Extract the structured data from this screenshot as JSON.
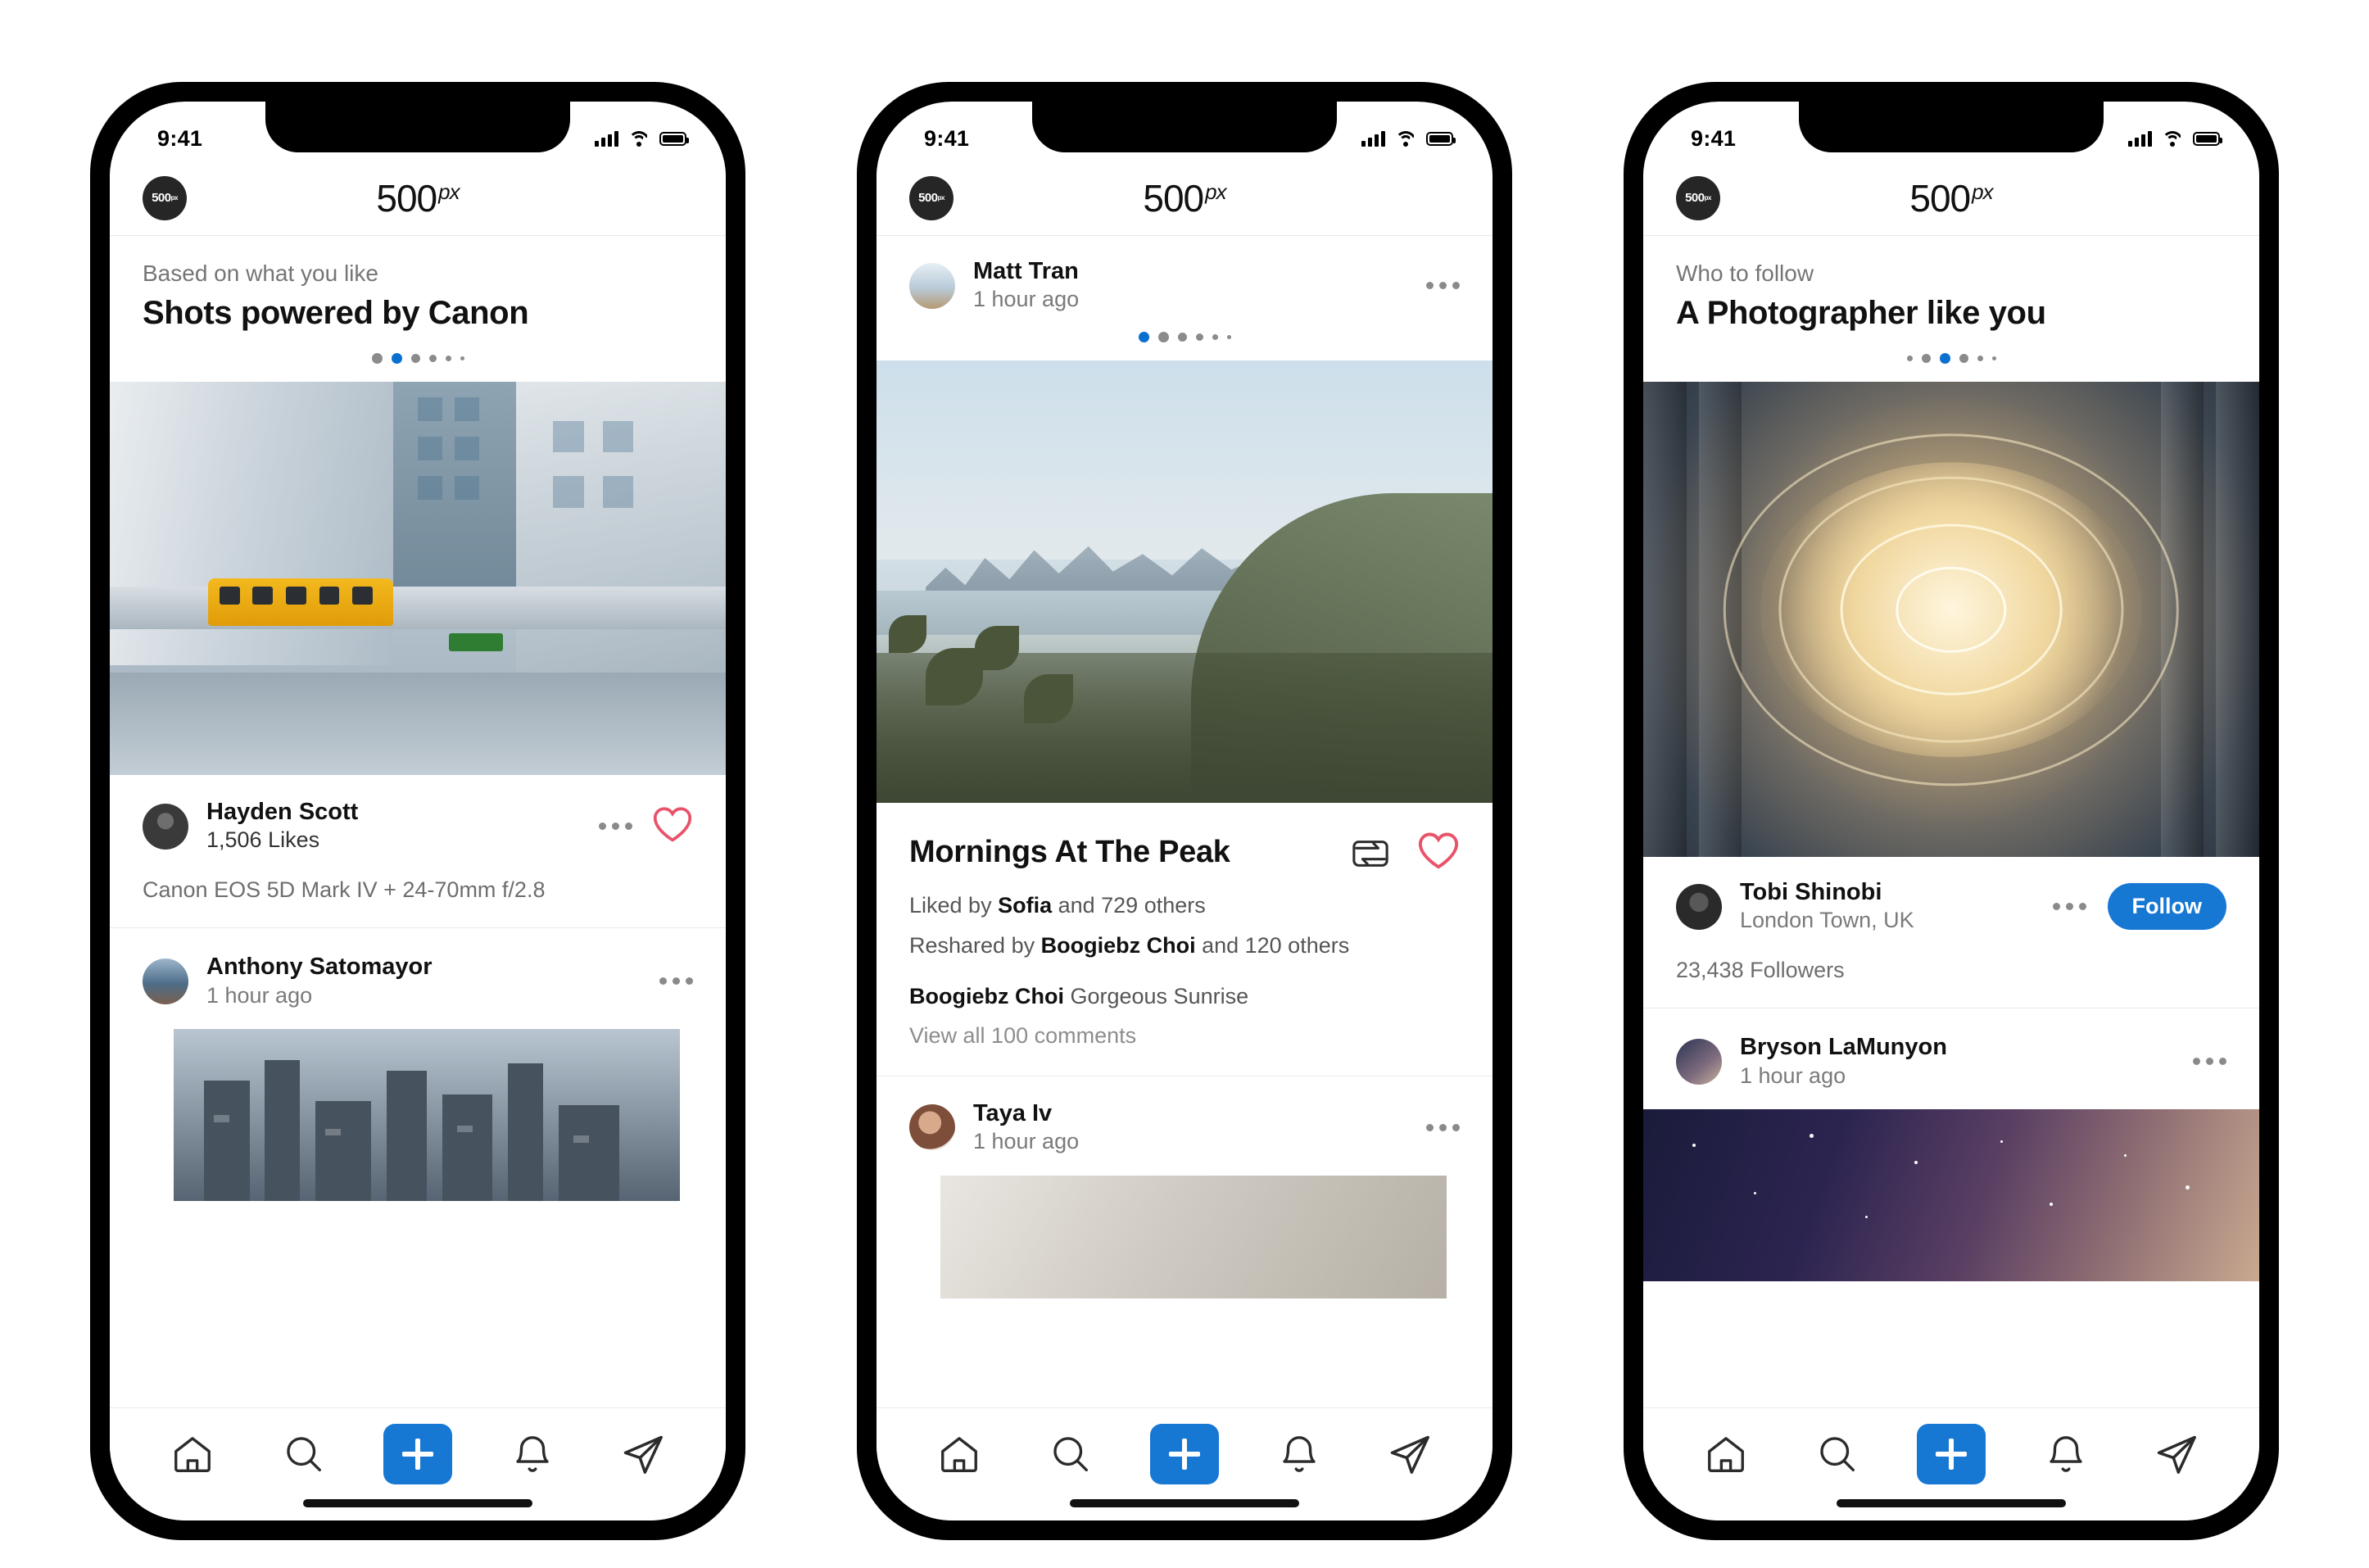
{
  "app": {
    "brand_name": "500",
    "brand_suffix": "px",
    "logo_text": "500",
    "logo_sup": "px"
  },
  "status_bar": {
    "time": "9:41",
    "signal_icon": "cellular-signal-icon",
    "wifi_icon": "wifi-icon",
    "battery_icon": "battery-icon"
  },
  "tab_bar": {
    "items": [
      {
        "name": "home",
        "icon": "home-icon"
      },
      {
        "name": "search",
        "icon": "search-icon"
      },
      {
        "name": "create",
        "icon": "plus-icon"
      },
      {
        "name": "notifications",
        "icon": "bell-icon"
      },
      {
        "name": "messages",
        "icon": "send-icon"
      }
    ]
  },
  "phones": [
    {
      "id": "phone-1",
      "section": {
        "kicker": "Based on what you like",
        "headline": "Shots powered by Canon",
        "pager": {
          "count": 6,
          "active_index": 1
        }
      },
      "post": {
        "author": "Hayden Scott",
        "likes": "1,506 Likes",
        "exif": "Canon EOS 5D Mark IV + 24-70mm f/2.8",
        "more_icon": "more-options-icon",
        "like_icon": "heart-icon"
      },
      "next_post": {
        "author": "Anthony Satomayor",
        "time": "1 hour ago",
        "more_icon": "more-options-icon"
      }
    },
    {
      "id": "phone-2",
      "post_header": {
        "author": "Matt Tran",
        "time": "1 hour ago",
        "more_icon": "more-options-icon",
        "pager": {
          "count": 6,
          "active_index": 0
        }
      },
      "post": {
        "title": "Mornings At The Peak",
        "reshare_icon": "reshare-icon",
        "like_icon": "heart-icon",
        "liked_by_prefix": "Liked by ",
        "liked_by_name": "Sofia",
        "liked_by_suffix": " and 729 others",
        "reshared_prefix": "Reshared by ",
        "reshared_name": "Boogiebz Choi",
        "reshared_suffix": " and 120 others",
        "comment_author": "Boogiebz Choi",
        "comment_text": " Gorgeous Sunrise",
        "view_comments": "View all 100 comments"
      },
      "next_post": {
        "author": "Taya Iv",
        "time": "1 hour ago",
        "more_icon": "more-options-icon"
      }
    },
    {
      "id": "phone-3",
      "section": {
        "kicker": "Who to follow",
        "headline": "A Photographer like you",
        "pager": {
          "count": 6,
          "active_index": 2
        }
      },
      "suggestion": {
        "name": "Tobi Shinobi",
        "location": "London Town, UK",
        "followers": "23,438 Followers",
        "follow_label": "Follow",
        "more_icon": "more-options-icon"
      },
      "next_post": {
        "author": "Bryson LaMunyon",
        "time": "1 hour ago",
        "more_icon": "more-options-icon"
      }
    }
  ],
  "colors": {
    "accent": "#1778d4",
    "heart": "#e8536a",
    "text": "#111111",
    "muted": "#7a7a7a"
  }
}
